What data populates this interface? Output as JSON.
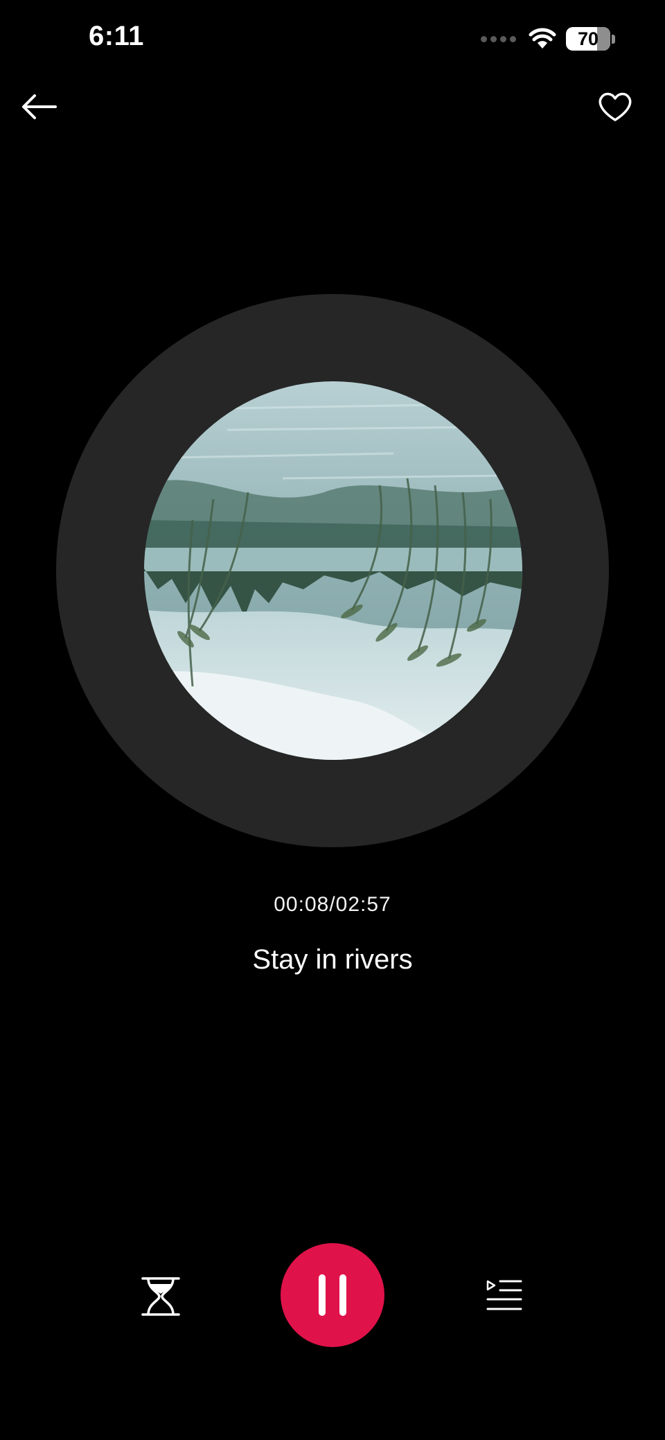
{
  "status_bar": {
    "time": "6:11",
    "battery_level": "70",
    "icons": [
      "cellular-signal-icon",
      "wifi-icon",
      "battery-icon"
    ]
  },
  "nav": {
    "back_icon": "arrow-left-icon",
    "favorite_icon": "heart-outline-icon"
  },
  "player": {
    "time_readout": "00:08/02:57",
    "track_title": "Stay in rivers",
    "is_playing": true
  },
  "controls": {
    "timer_icon": "hourglass-icon",
    "play_pause_icon": "pause-icon",
    "playlist_icon": "playlist-icon"
  },
  "colors": {
    "background": "#000000",
    "disc": "#262626",
    "accent": "#e0124a",
    "text": "#ffffff"
  }
}
